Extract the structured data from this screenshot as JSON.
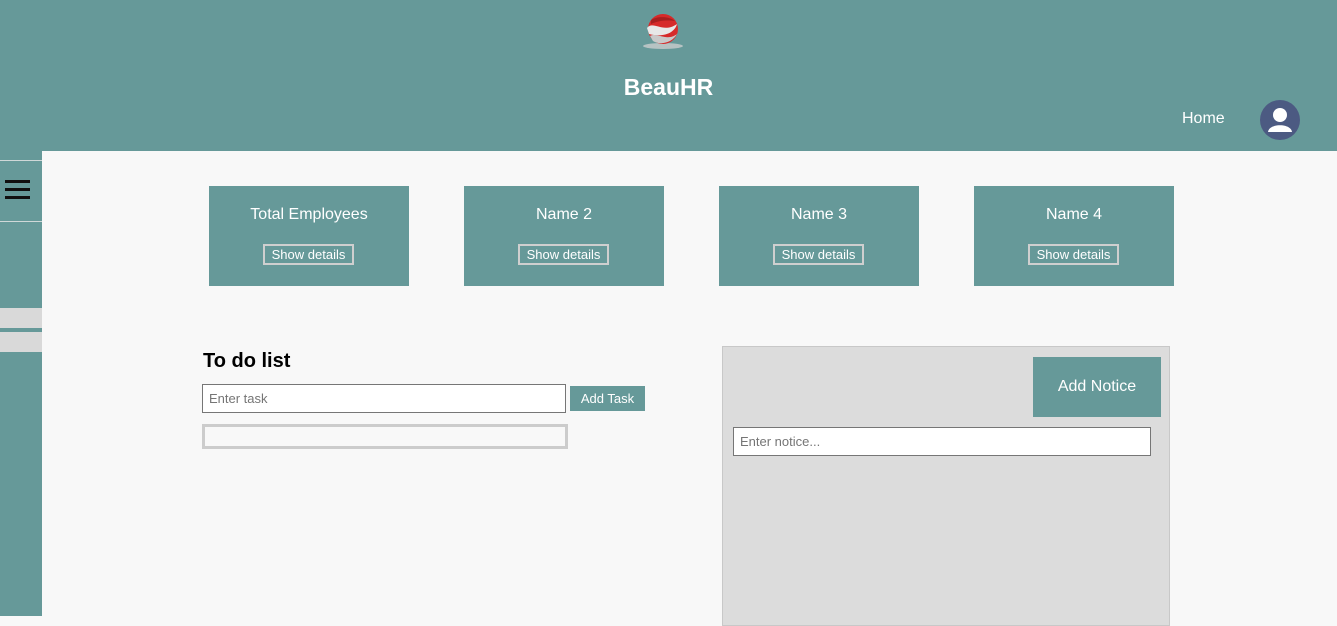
{
  "header": {
    "brand": "BeauHR",
    "logo_icon": "brand-logo-icon",
    "nav_home": "Home",
    "avatar_icon": "user-avatar-icon",
    "color": "#669999"
  },
  "sidebar": {
    "menu_icon": "hamburger-menu-icon"
  },
  "cards": [
    {
      "title": "Total Employees",
      "button": "Show details"
    },
    {
      "title": "Name 2",
      "button": "Show details"
    },
    {
      "title": "Name 3",
      "button": "Show details"
    },
    {
      "title": "Name 4",
      "button": "Show details"
    }
  ],
  "todo": {
    "title": "To do list",
    "input_placeholder": "Enter task",
    "input_value": "",
    "add_button": "Add Task"
  },
  "notice": {
    "add_button": "Add Notice",
    "input_placeholder": "Enter notice...",
    "input_value": ""
  }
}
